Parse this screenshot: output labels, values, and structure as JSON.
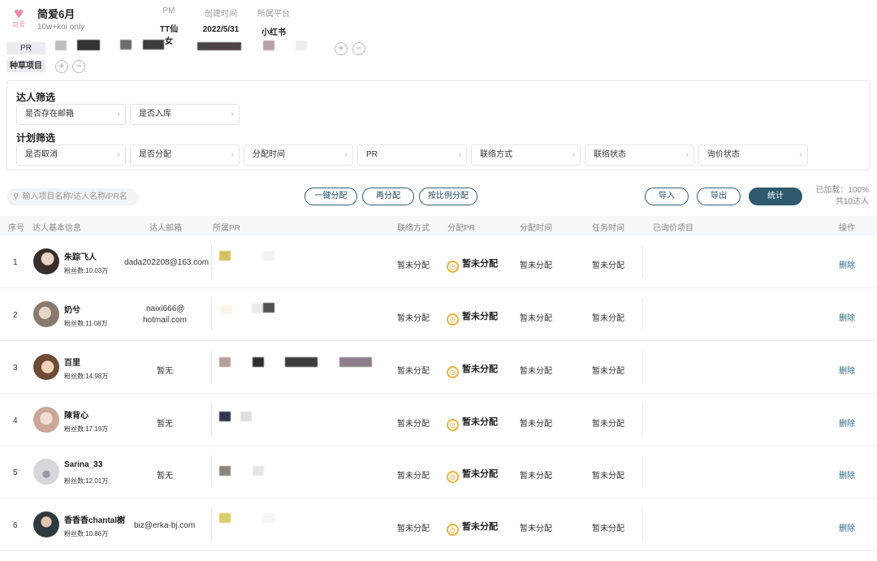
{
  "project": {
    "logo_text": "简爱",
    "title": "简爱6月",
    "subtitle": "10w+koi only",
    "meta": [
      {
        "label": "PM",
        "value": "TT仙女"
      },
      {
        "label": "创建时间",
        "value": "2022/5/31"
      },
      {
        "label": "所属平台",
        "value": "小红书"
      }
    ],
    "pr_tag": "PR",
    "seeding_tag": "种草项目",
    "add_symbol": "+",
    "remove_symbol": "−"
  },
  "filters": {
    "influencer_title": "达人筛选",
    "influencer_fields": [
      "是否存在邮箱",
      "是否入库"
    ],
    "plan_title": "计划筛选",
    "plan_fields": [
      "是否取消",
      "是否分配",
      "分配时间",
      "PR",
      "联络方式",
      "联络状态",
      "询价状态"
    ]
  },
  "toolbar": {
    "search_placeholder": "输入项目名称/达人名称/PR名",
    "btn_one_click": "一键分配",
    "btn_reassign": "再分配",
    "btn_ratio": "按比例分配",
    "btn_import": "导入",
    "btn_export": "导出",
    "btn_stats": "统计",
    "loaded_text": "已加载：100%",
    "count_text": "共10达人"
  },
  "table": {
    "headers": [
      "序号",
      "达人基本信息",
      "达人邮箱",
      "所属PR",
      "联络方式",
      "分配PR",
      "分配时间",
      "任务时间",
      "已询价项目",
      "操作"
    ],
    "rows": [
      {
        "idx": "1",
        "name": "朱踪飞人",
        "fans": "粉丝数:10.03万",
        "email": "dada202208@163.com",
        "email2": "",
        "contact": "暂未分配",
        "assigned": "暂未分配",
        "assign_time": "暂未分配",
        "task_time": "暂未分配",
        "action": "删除"
      },
      {
        "idx": "2",
        "name": "奶兮",
        "fans": "粉丝数:11.08万",
        "email": "naixi666@",
        "email2": "hotmail.com",
        "contact": "暂未分配",
        "assigned": "暂未分配",
        "assign_time": "暂未分配",
        "task_time": "暂未分配",
        "action": "删除"
      },
      {
        "idx": "3",
        "name": "百里",
        "fans": "粉丝数:14.98万",
        "email": "暂无",
        "email2": "",
        "contact": "暂未分配",
        "assigned": "暂未分配",
        "assign_time": "暂未分配",
        "task_time": "暂未分配",
        "action": "删除"
      },
      {
        "idx": "4",
        "name": "陳背心",
        "fans": "粉丝数:17.19万",
        "email": "暂无",
        "email2": "",
        "contact": "暂未分配",
        "assigned": "暂未分配",
        "assign_time": "暂未分配",
        "task_time": "暂未分配",
        "action": "删除"
      },
      {
        "idx": "5",
        "name": "Sarina_33",
        "fans": "粉丝数:12.01万",
        "email": "暂无",
        "email2": "",
        "contact": "暂未分配",
        "assigned": "暂未分配",
        "assign_time": "暂未分配",
        "task_time": "暂未分配",
        "action": "删除"
      },
      {
        "idx": "6",
        "name": "香香香chantal榭",
        "fans": "粉丝数:10.86万",
        "email": "biz@erka-bj.com",
        "email2": "",
        "contact": "暂未分配",
        "assigned": "暂未分配",
        "assign_time": "暂未分配",
        "task_time": "暂未分配",
        "action": "删除"
      }
    ]
  },
  "colors": {
    "accent": "#2e5a6c",
    "link": "#2f6c86",
    "status_icon": "#f0b233",
    "logo": "#e88aa3"
  }
}
